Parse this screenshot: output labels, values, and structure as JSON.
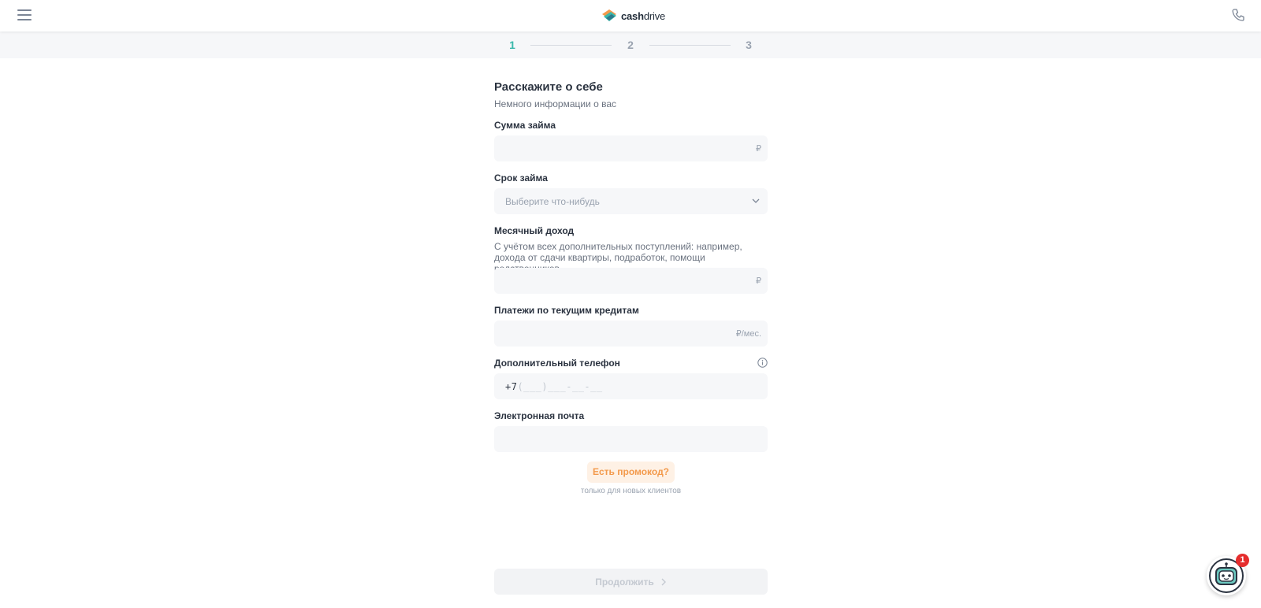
{
  "header": {
    "logo_cash": "cash",
    "logo_drive": "drive",
    "menu_icon": "hamburger-menu-icon",
    "phone_icon": "phone-icon"
  },
  "steps": [
    "1",
    "2",
    "3"
  ],
  "active_step": 1,
  "form": {
    "title": "Расскажите о себе",
    "subtitle": "Немного информации о вас",
    "loan_amount": {
      "label": "Сумма займа",
      "suffix": "₽",
      "value": ""
    },
    "loan_term": {
      "label": "Срок займа",
      "placeholder": "Выберите что-нибудь"
    },
    "monthly_income": {
      "label": "Месячный доход",
      "hint": "С учётом всех дополнительных поступлений: например, дохода от сдачи квартиры, подработок, помощи родственников",
      "suffix": "₽",
      "value": ""
    },
    "current_payments": {
      "label": "Платежи по текущим кредитам",
      "suffix": "₽/мес.",
      "value": ""
    },
    "extra_phone": {
      "label": "Дополнительный телефон",
      "prefix": "+7",
      "mask": "(___)___-__-__"
    },
    "email": {
      "label": "Электронная почта",
      "value": ""
    },
    "promo_button": "Есть промокод?",
    "promo_note": "только для новых клиентов"
  },
  "continue_button": "Продолжить",
  "chat": {
    "badge": "1"
  },
  "colors": {
    "accent": "#3bb8ab",
    "promo": "#f39a4c",
    "badge": "#e52d2d"
  }
}
